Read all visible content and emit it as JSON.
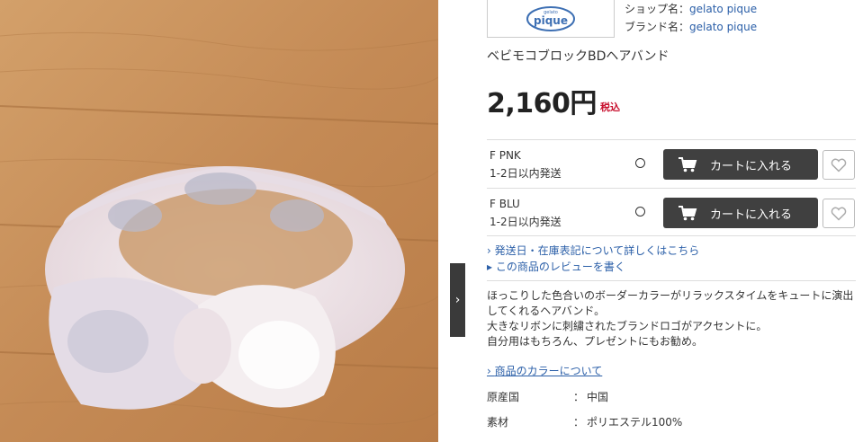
{
  "shop": {
    "logo_text": "pique",
    "logo_small": "gelato",
    "shop_label": "ショップ名：",
    "shop_name": "gelato pique",
    "brand_label": "ブランド名：",
    "brand_name": "gelato pique"
  },
  "product": {
    "title": "ベビモコブロックBDヘアバンド",
    "price": "2,160円",
    "tax_label": "税込"
  },
  "variants": [
    {
      "color": "F PNK",
      "shipping": "1-2日以内発送",
      "stock_mark": "○",
      "cart_label": "カートに入れる"
    },
    {
      "color": "F BLU",
      "shipping": "1-2日以内発送",
      "stock_mark": "○",
      "cart_label": "カートに入れる"
    }
  ],
  "links": {
    "shipping_info": "発送日・在庫表記について詳しくはこちら",
    "reviews": "この商品のレビューを書く",
    "color_info": "商品のカラーについて"
  },
  "description": [
    "ほっこりした色合いのボーダーカラーがリラックスタイムをキュートに演出",
    "してくれるヘアバンド。",
    "大きなリボンに刺繍されたブランドロゴがアクセントに。",
    "自分用はもちろん、プレゼントにもお勧め。"
  ],
  "specs": [
    {
      "key": "原産国",
      "sep": "：",
      "value": "中国"
    },
    {
      "key": "素材",
      "sep": "：",
      "value": "ポリエステル100%"
    }
  ],
  "icons": {
    "next": "chevron-right-icon",
    "cart": "cart-icon",
    "wishlist": "heart-icon",
    "link_arrow": "chevron-right-icon",
    "review_bullet": "triangle-bullet-icon"
  },
  "colors": {
    "link": "#2b5fa8",
    "price_tax": "#c8102e",
    "cart_button": "#404040",
    "wood": "#c8915a"
  }
}
